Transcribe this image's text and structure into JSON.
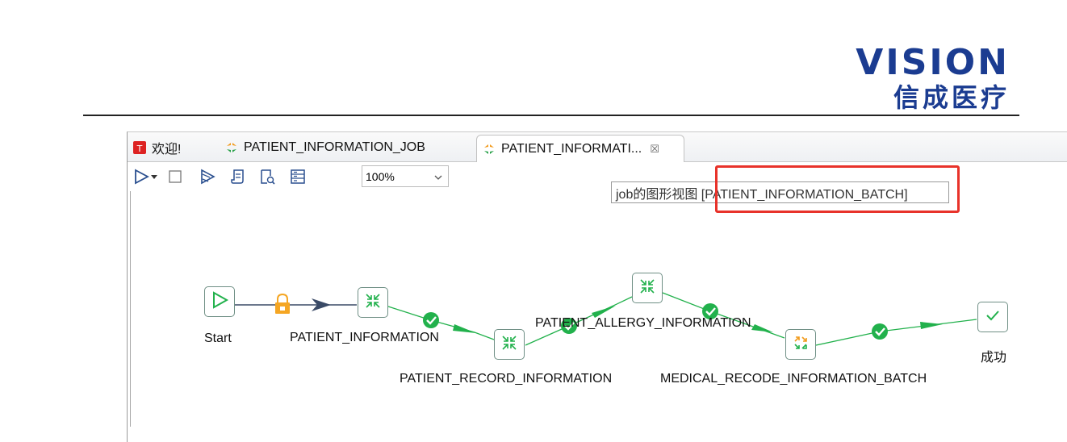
{
  "brand": {
    "name_en": "VISION",
    "name_cn": "信成医疗"
  },
  "tabs": [
    {
      "label": "欢迎!",
      "icon": "welcome-icon"
    },
    {
      "label": "PATIENT_INFORMATION_JOB",
      "icon": "job-icon"
    },
    {
      "label": "PATIENT_INFORMATI...",
      "icon": "job-icon",
      "close": "☒"
    }
  ],
  "toolbar": {
    "zoom": "100%"
  },
  "tooltip": {
    "text": "job的图形视图 [PATIENT_INFORMATION_BATCH]"
  },
  "nodes": {
    "start": "Start",
    "patient_information": "PATIENT_INFORMATION",
    "patient_record_information": "PATIENT_RECORD_INFORMATION",
    "patient_allergy_information": "PATIENT_ALLERGY_INFORMATION",
    "medical_recode_information_batch": "MEDICAL_RECODE_INFORMATION_BATCH",
    "success": "成功"
  },
  "colors": {
    "brand": "#1b3c91",
    "flow_ok": "#22b14c",
    "highlight": "#e8322a"
  }
}
